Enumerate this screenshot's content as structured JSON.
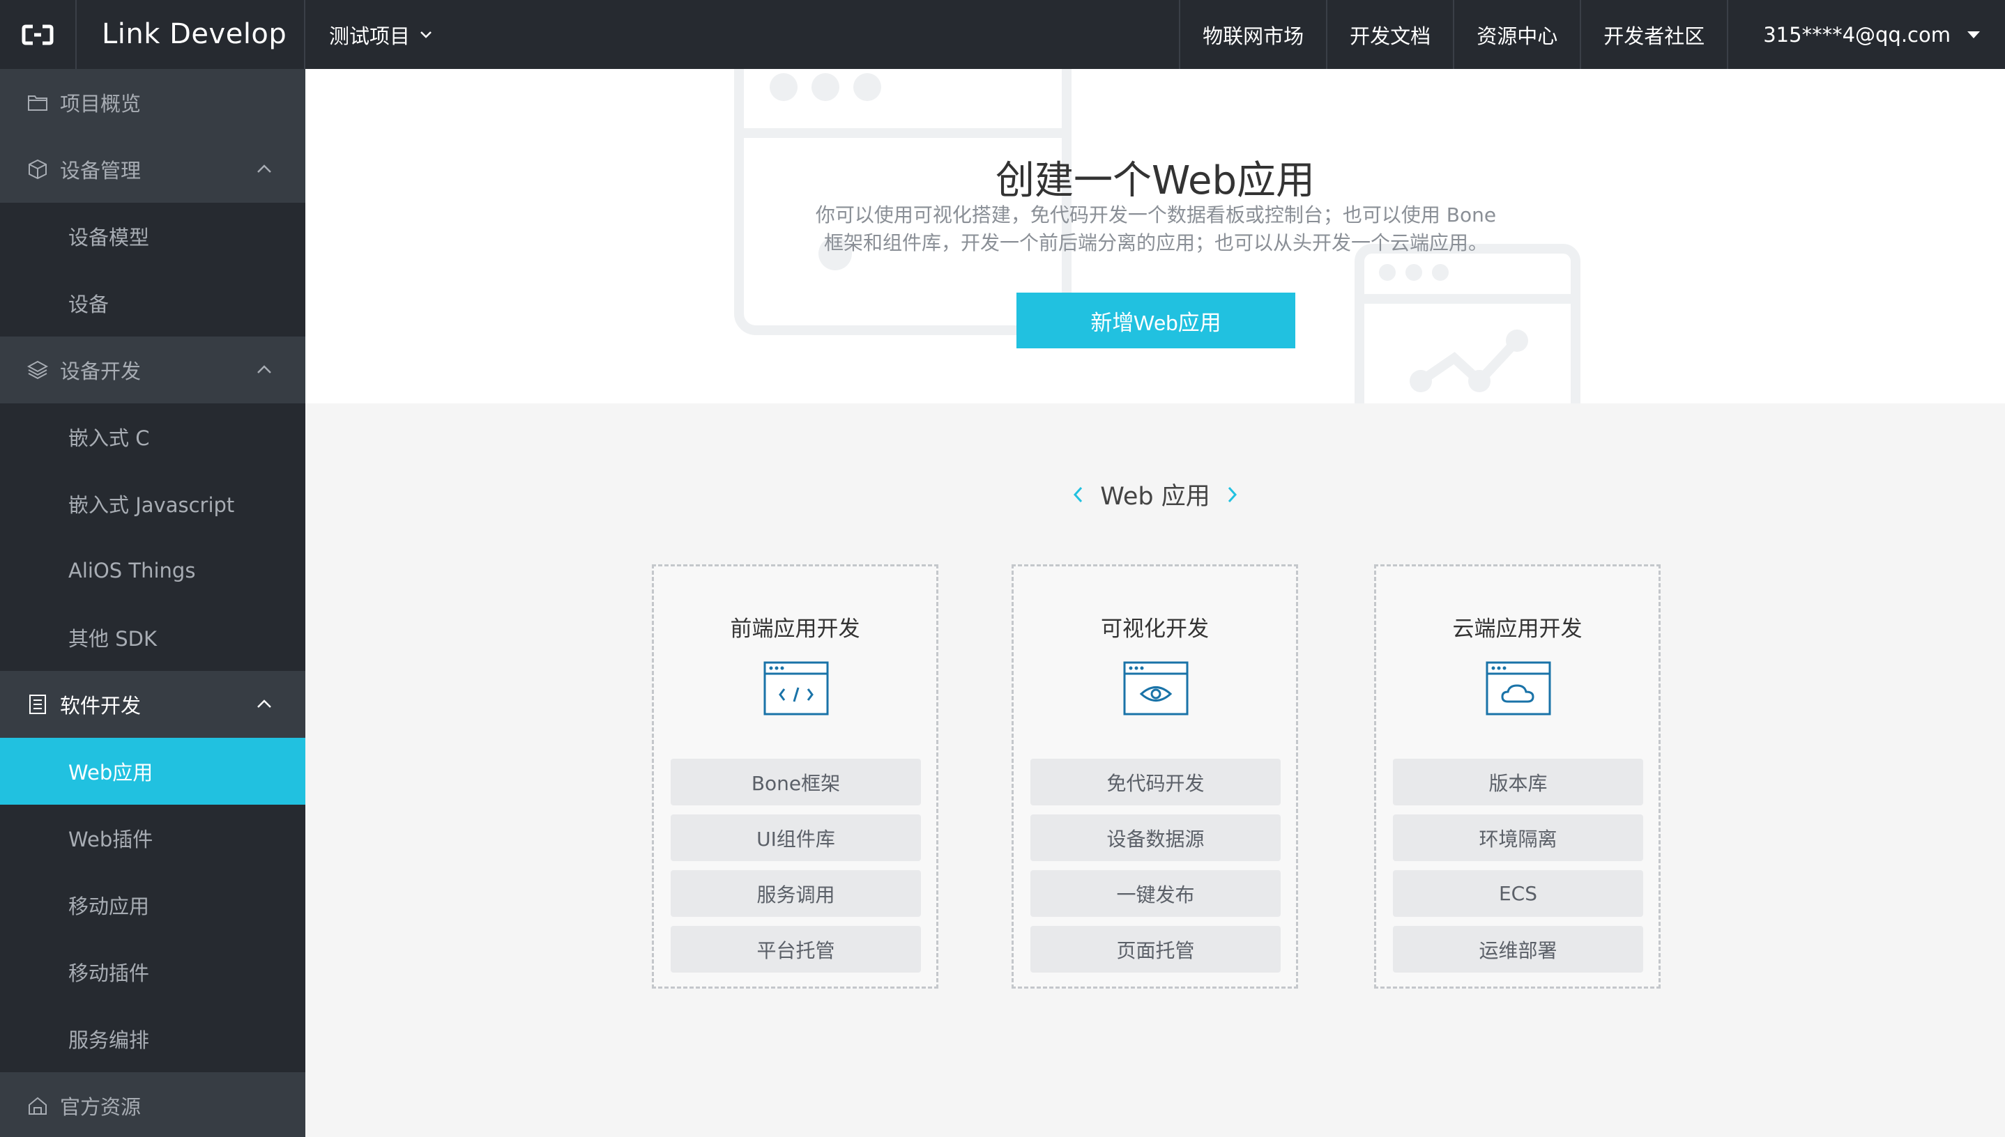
{
  "header": {
    "brand": "Link Develop",
    "project": "测试项目",
    "nav": [
      "物联网市场",
      "开发文档",
      "资源中心",
      "开发者社区"
    ],
    "user": "315****4@qq.com"
  },
  "sidebar": {
    "overview": "项目概览",
    "device_mgmt": "设备管理",
    "device_model": "设备模型",
    "device": "设备",
    "device_dev": "设备开发",
    "embedded_c": "嵌入式 C",
    "embedded_js": "嵌入式 Javascript",
    "alios": "AliOS Things",
    "other_sdk": "其他 SDK",
    "software_dev": "软件开发",
    "web_app": "Web应用",
    "web_plugin": "Web插件",
    "mobile_app": "移动应用",
    "mobile_plugin": "移动插件",
    "service_orch": "服务编排",
    "official": "官方资源"
  },
  "hero": {
    "title": "创建一个Web应用",
    "desc_line1": "你可以使用可视化搭建，免代码开发一个数据看板或控制台；也可以使用 Bone",
    "desc_line2": "框架和组件库，开发一个前后端分离的应用；也可以从头开发一个云端应用。",
    "button": "新增Web应用"
  },
  "section": {
    "title": "Web 应用"
  },
  "cards": [
    {
      "title": "前端应用开发",
      "icon": "code-window-icon",
      "tags": [
        "Bone框架",
        "UI组件库",
        "服务调用",
        "平台托管"
      ]
    },
    {
      "title": "可视化开发",
      "icon": "eye-window-icon",
      "tags": [
        "免代码开发",
        "设备数据源",
        "一键发布",
        "页面托管"
      ]
    },
    {
      "title": "云端应用开发",
      "icon": "cloud-window-icon",
      "tags": [
        "版本库",
        "环境隔离",
        "ECS",
        "运维部署"
      ]
    }
  ],
  "colors": {
    "accent": "#21c1e0",
    "topbar": "#262a30",
    "sidebar": "#373d44",
    "sidebar_sub": "#262a30"
  }
}
